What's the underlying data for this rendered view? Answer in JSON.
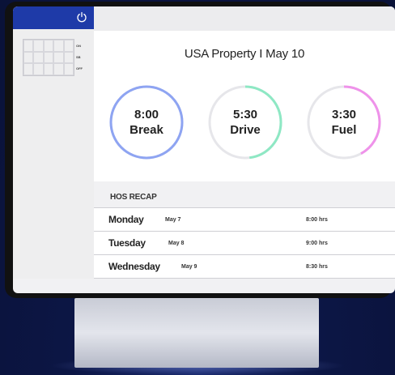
{
  "colors": {
    "sidebar_header": "#1e3aa8",
    "break_ring": "#8ea4f2",
    "drive_ring": "#8ee8c4",
    "fuel_ring": "#ef92ea",
    "ring_track": "#e6e6ea"
  },
  "sidebar": {
    "power_icon": "power-icon",
    "legend": [
      "ON",
      "SB",
      "OFF"
    ]
  },
  "main": {
    "title": "USA Property I May 10",
    "gauges": [
      {
        "time": "8:00",
        "label": "Break",
        "progress": 1.0
      },
      {
        "time": "5:30",
        "label": "Drive",
        "progress": 0.48
      },
      {
        "time": "3:30",
        "label": "Fuel",
        "progress": 0.42
      }
    ]
  },
  "recap": {
    "label": "HOS RECAP",
    "rows": [
      {
        "day": "Monday",
        "date": "May 7",
        "hours": "8:00 hrs"
      },
      {
        "day": "Tuesday",
        "date": "May 8",
        "hours": "9:00 hrs"
      },
      {
        "day": "Wednesday",
        "date": "May 9",
        "hours": "8:30 hrs"
      }
    ]
  }
}
